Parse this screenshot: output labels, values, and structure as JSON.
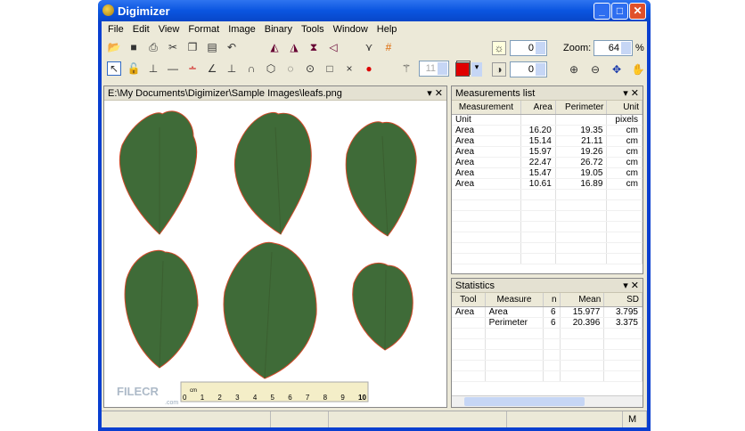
{
  "window": {
    "title": "Digimizer",
    "minimize": "_",
    "maximize": "□",
    "close": "✕"
  },
  "menu": [
    "File",
    "Edit",
    "View",
    "Format",
    "Image",
    "Binary",
    "Tools",
    "Window",
    "Help"
  ],
  "toolbar": {
    "brightness": "0",
    "contrast": "0",
    "zoom_label": "Zoom:",
    "zoom_value": "64",
    "zoom_unit": "%",
    "wand_value": "11",
    "color": "#e00000"
  },
  "image_panel": {
    "title": "E:\\My Documents\\Digimizer\\Sample Images\\leafs.png",
    "ruler_labels": [
      "0",
      "1",
      "2",
      "3",
      "4",
      "5",
      "6",
      "7",
      "8",
      "9",
      "10"
    ],
    "ruler_unit": "cm",
    "watermark": "FILECR",
    "watermark_sub": ".com"
  },
  "measurements": {
    "title": "Measurements list",
    "columns": [
      "Measurement",
      "Area",
      "Perimeter",
      "Unit"
    ],
    "rows": [
      [
        "Unit",
        "",
        "",
        "pixels"
      ],
      [
        "Area",
        "16.20",
        "19.35",
        "cm"
      ],
      [
        "Area",
        "15.14",
        "21.11",
        "cm"
      ],
      [
        "Area",
        "15.97",
        "19.26",
        "cm"
      ],
      [
        "Area",
        "22.47",
        "26.72",
        "cm"
      ],
      [
        "Area",
        "15.47",
        "19.05",
        "cm"
      ],
      [
        "Area",
        "10.61",
        "16.89",
        "cm"
      ]
    ]
  },
  "statistics": {
    "title": "Statistics",
    "columns": [
      "Tool",
      "Measure",
      "n",
      "Mean",
      "SD"
    ],
    "rows": [
      [
        "Area",
        "Area",
        "6",
        "15.977",
        "3.795"
      ],
      [
        "",
        "Perimeter",
        "6",
        "20.396",
        "3.375"
      ]
    ]
  },
  "status": {
    "mode": "M"
  }
}
